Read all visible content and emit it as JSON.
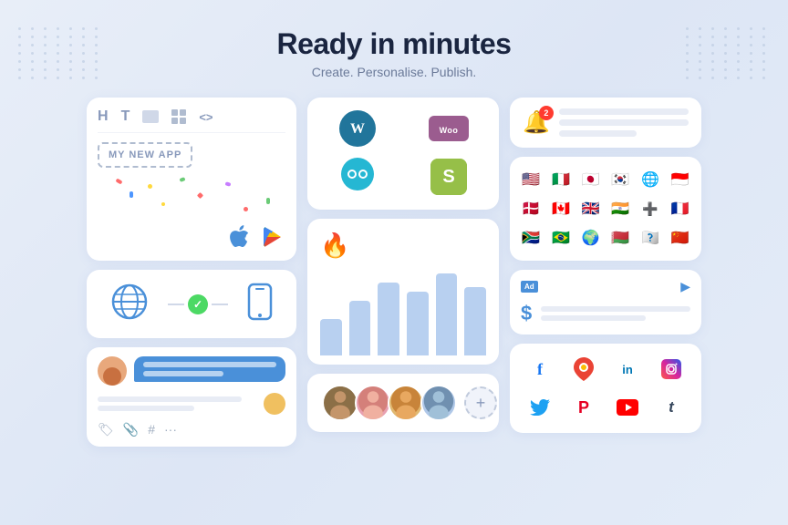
{
  "header": {
    "title": "Ready in minutes",
    "subtitle": "Create. Personalise. Publish."
  },
  "cards": {
    "editor": {
      "toolbar": [
        "H",
        "T",
        "🖼",
        "▦",
        "<>"
      ],
      "app_name": "MY NEW APP",
      "add_label": "+"
    },
    "platforms": {
      "wordpress_label": "W",
      "woo_label": "Woo",
      "opencart_label": "●●",
      "shopify_label": "S"
    },
    "chart": {
      "bars": [
        40,
        60,
        80,
        70,
        90,
        75
      ],
      "firebase_emoji": "🔥"
    },
    "team": {
      "add_label": "+"
    },
    "notification": {
      "badge": "2",
      "bell": "🔔"
    },
    "flags": [
      "🇺🇸",
      "🇮🇹",
      "🇯🇵",
      "🇰🇷",
      "🌐",
      "🇮🇩",
      "🇩🇰",
      "🇨🇦",
      "🇬🇧",
      "🇮🇳",
      "➕",
      "🇫🇷",
      "🇿🇦",
      "🇧🇷",
      "🌍",
      "🇧🇾",
      "🏴",
      "🇨🇳"
    ],
    "ad": {
      "badge": "Ad",
      "dollar": "$"
    },
    "social": {
      "icons": [
        {
          "name": "facebook",
          "label": "f",
          "color": "#1877f2"
        },
        {
          "name": "google-maps",
          "label": "📍",
          "color": "#ea4335"
        },
        {
          "name": "linkedin",
          "label": "in",
          "color": "#0077b5"
        },
        {
          "name": "instagram",
          "label": "📷",
          "color": "#e1306c"
        },
        {
          "name": "twitter",
          "label": "𝕏",
          "color": "#1da1f2"
        },
        {
          "name": "pinterest",
          "label": "P",
          "color": "#e60023"
        },
        {
          "name": "youtube",
          "label": "▶",
          "color": "#ff0000"
        },
        {
          "name": "tumblr",
          "label": "t",
          "color": "#35465c"
        }
      ]
    }
  }
}
